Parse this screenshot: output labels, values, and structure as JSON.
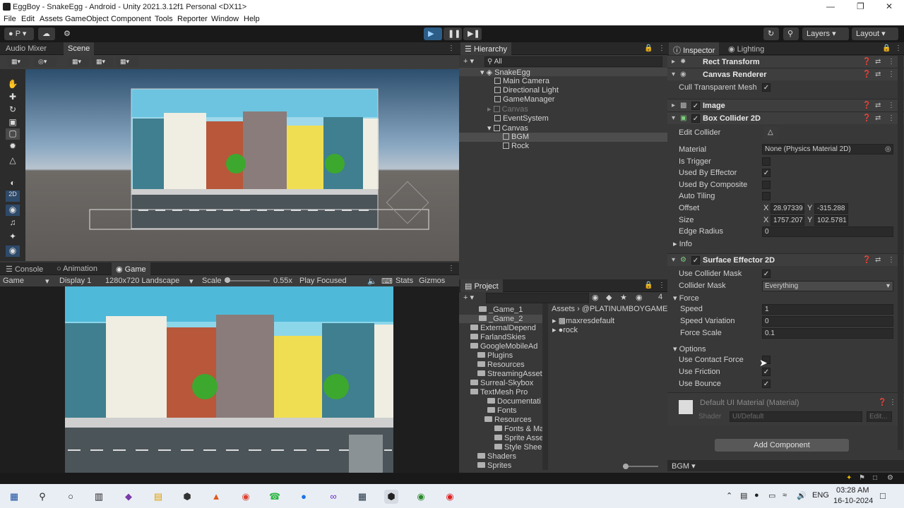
{
  "window": {
    "title": "EggBoy - SnakeEgg - Android - Unity 2021.3.12f1 Personal <DX11>"
  },
  "menu": [
    "File",
    "Edit",
    "Assets",
    "GameObject",
    "Component",
    "Tools",
    "Reporter",
    "Window",
    "Help"
  ],
  "toolbar": {
    "account": "P",
    "layers": "Layers",
    "layout": "Layout"
  },
  "scene_panel": {
    "tabs": [
      "Audio Mixer",
      "Scene"
    ]
  },
  "game_panel": {
    "tabs": [
      "Console",
      "Animation",
      "Game"
    ],
    "display": "Game",
    "display_num": "Display 1",
    "resolution": "1280x720 Landscape",
    "scale_label": "Scale",
    "scale_value": "0.55x",
    "play_mode": "Play Focused",
    "stats": "Stats",
    "gizmos": "Gizmos"
  },
  "hierarchy": {
    "tab": "Hierarchy",
    "search_placeholder": "All",
    "items": [
      {
        "label": "SnakeEgg",
        "indent": 0
      },
      {
        "label": "Main Camera",
        "indent": 1
      },
      {
        "label": "Directional Light",
        "indent": 1
      },
      {
        "label": "GameManager",
        "indent": 1
      },
      {
        "label": "Canvas",
        "indent": 1,
        "dim": true
      },
      {
        "label": "EventSystem",
        "indent": 1
      },
      {
        "label": "Canvas",
        "indent": 1
      },
      {
        "label": "BGM",
        "indent": 2,
        "selected": true
      },
      {
        "label": "Rock",
        "indent": 2
      }
    ]
  },
  "project": {
    "tab": "Project",
    "count": "4",
    "breadcrumb": [
      "Assets",
      "@PLATINUMBOYGAME"
    ],
    "folders": [
      "_Game_1",
      "_Game_2",
      "ExternalDepend",
      "FarlandSkies",
      "GoogleMobileAd",
      "Plugins",
      "Resources",
      "StreamingAsset",
      "Surreal-Skybox",
      "TextMesh Pro",
      "Documentati",
      "Fonts",
      "Resources",
      "Fonts & Ma",
      "Sprite Asse",
      "Style Shee",
      "Shaders",
      "Sprites"
    ],
    "assets": [
      "maxresdefault",
      "rock"
    ]
  },
  "inspector": {
    "tabs": [
      "Inspector",
      "Lighting"
    ],
    "rect_transform": "Rect Transform",
    "canvas_renderer": "Canvas Renderer",
    "cull_transparent": "Cull Transparent Mesh",
    "image": "Image",
    "box_collider": {
      "title": "Box Collider 2D",
      "edit_collider": "Edit Collider",
      "material_label": "Material",
      "material_value": "None (Physics Material 2D)",
      "is_trigger": "Is Trigger",
      "used_by_effector": "Used By Effector",
      "used_by_composite": "Used By Composite",
      "auto_tiling": "Auto Tiling",
      "offset_label": "Offset",
      "offset_x": "28.97339",
      "offset_y": "-315.288",
      "size_label": "Size",
      "size_x": "1757.207",
      "size_y": "102.5781",
      "edge_radius_label": "Edge Radius",
      "edge_radius": "0",
      "info": "Info",
      "x": "X",
      "y": "Y"
    },
    "surface_effector": {
      "title": "Surface Effector 2D",
      "use_collider_mask": "Use Collider Mask",
      "collider_mask_label": "Collider Mask",
      "collider_mask_value": "Everything",
      "force": "Force",
      "speed_label": "Speed",
      "speed": "1",
      "speed_var_label": "Speed Variation",
      "speed_var": "0",
      "force_scale_label": "Force Scale",
      "force_scale": "0.1",
      "options": "Options",
      "use_contact_force": "Use Contact Force",
      "use_friction": "Use Friction",
      "use_bounce": "Use Bounce"
    },
    "material": {
      "name": "Default UI Material (Material)",
      "shader_label": "Shader",
      "shader_value": "UI/Default",
      "edit": "Edit..."
    },
    "add_component": "Add Component",
    "status": "BGM"
  },
  "taskbar": {
    "time": "03:28 AM",
    "date": "16-10-2024",
    "lang": "ENG"
  }
}
